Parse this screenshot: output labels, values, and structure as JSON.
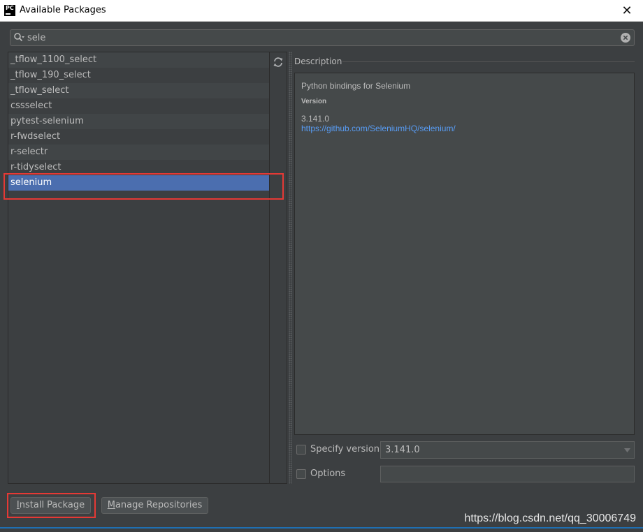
{
  "window": {
    "icon_text": "PC",
    "title": "Available Packages",
    "close": "✕"
  },
  "search": {
    "value": "sele",
    "placeholder": ""
  },
  "packages": [
    {
      "name": "_tflow_1100_select"
    },
    {
      "name": "_tflow_190_select"
    },
    {
      "name": "_tflow_select"
    },
    {
      "name": "cssselect"
    },
    {
      "name": "pytest-selenium"
    },
    {
      "name": "r-fwdselect"
    },
    {
      "name": "r-selectr"
    },
    {
      "name": "r-tidyselect"
    },
    {
      "name": "selenium",
      "selected": true
    }
  ],
  "description": {
    "header": "Description",
    "text": "Python bindings for Selenium",
    "version_label": "Version",
    "version": "3.141.0",
    "homepage": "https://github.com/SeleniumHQ/selenium/"
  },
  "options": {
    "specify_version_label": "Specify version",
    "specify_version_checked": false,
    "version_selected": "3.141.0",
    "options_label": "Options",
    "options_checked": false,
    "options_value": ""
  },
  "buttons": {
    "install_mnemonic": "I",
    "install_rest": "nstall Package",
    "manage_mnemonic": "M",
    "manage_rest": "anage Repositories"
  },
  "watermark": "https://blog.csdn.net/qq_30006749",
  "colors": {
    "background": "#3c3f41",
    "selection": "#4b6eaf",
    "link": "#589df6",
    "highlight": "#e53935"
  }
}
